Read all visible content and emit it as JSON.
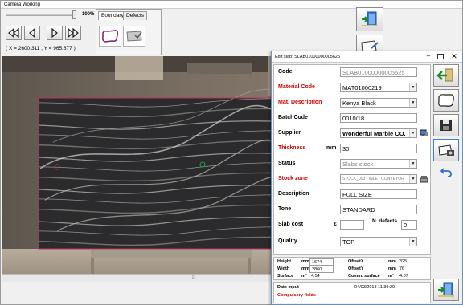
{
  "main_window": {
    "title": "Camera Working",
    "zoom_value": "100%",
    "zoom_level": 1.0,
    "coordinates": "( X = 2600.311 , Y = 965.677 )",
    "tabs": [
      {
        "label": "Boundary",
        "active": true
      },
      {
        "label": "Defects",
        "active": false
      }
    ],
    "bottom_grip": "⁞⁞⁞"
  },
  "dialog": {
    "title": "Edit slab: SLAB01000000005625",
    "close_glyph": "✕",
    "min_glyph": "–",
    "fields": {
      "code": {
        "label": "Code",
        "value": "SLAB01000000005625"
      },
      "material_code": {
        "label": "Material Code",
        "value": "MAT01000219"
      },
      "mat_description": {
        "label": "Mat. Description",
        "value": "Kenya Black"
      },
      "batch_code": {
        "label": "BatchCode",
        "value": "0010/18"
      },
      "supplier": {
        "label": "Supplier",
        "value": "Wonderful Marble CO."
      },
      "thickness": {
        "label": "Thickness",
        "unit": "mm",
        "value": "30"
      },
      "status": {
        "label": "Status",
        "value": "Slabs stock"
      },
      "stock_zone": {
        "label": "Stock zone",
        "value": "STOCK_003 - INLET CONVEYOR"
      },
      "description": {
        "label": "Description",
        "value": "FULL SIZE"
      },
      "tone": {
        "label": "Tone",
        "value": "STANDARD"
      },
      "slab_cost": {
        "label": "Slab cost",
        "unit": "€",
        "value": ""
      },
      "n_defects": {
        "label": "N. defects",
        "value": "0"
      },
      "quality": {
        "label": "Quality",
        "value": "TOP"
      }
    },
    "dimensions": {
      "height_label": "Height",
      "height_unit": "mm",
      "height_value": "1674",
      "width_label": "Width",
      "width_unit": "mm",
      "width_value": "2860",
      "surface_label": "Surface",
      "surface_unit": "m²",
      "surface_value": "4.54",
      "offsetx_label": "OffsetX",
      "offsetx_unit": "mm",
      "offsetx_value": "325",
      "offsety_label": "OffsetY",
      "offsety_unit": "mm",
      "offsety_value": "76",
      "comm_surface_label": "Comm. surface",
      "comm_surface_unit": "m²",
      "comm_surface_value": "4.07"
    },
    "date_input_label": "Date input",
    "date_input_value": "04/03/2018 11:39:29",
    "compulsory_label": "Compulsory fields"
  },
  "colors": {
    "required_label": "#d10000",
    "boundary": "#c0305a",
    "dialog_border": "#6e8fb7"
  },
  "icons": {
    "main_side_buttons": [
      "exit-door-icon",
      "slab-edit-icon"
    ],
    "dialog_buttons": [
      "back-arrow-icon",
      "slab-outline-icon",
      "save-disk-icon",
      "slab-camera-icon",
      "undo-icon"
    ],
    "tab_icons": [
      "boundary-shape-icon",
      "defect-shape-icon"
    ],
    "nav": [
      "first-icon",
      "previous-icon",
      "next-icon",
      "last-icon"
    ]
  }
}
